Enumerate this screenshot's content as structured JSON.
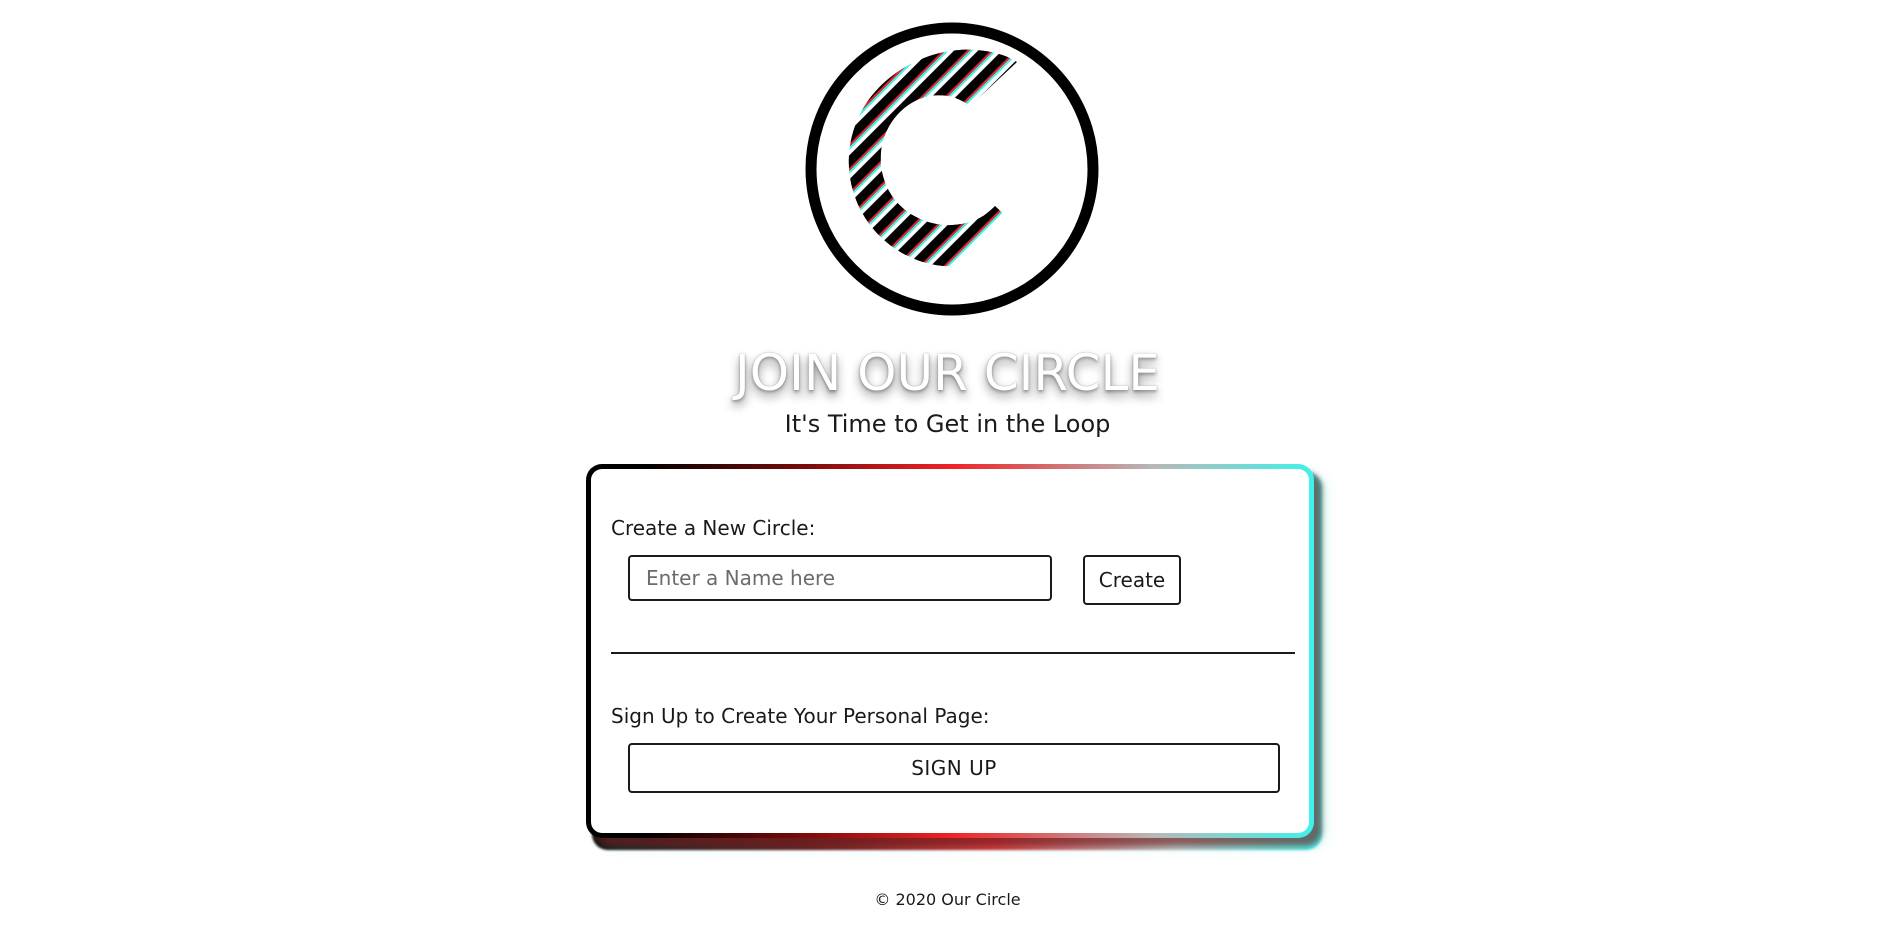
{
  "logo": {
    "icon": "our-circle-logo-icon",
    "accent_colors": [
      "#000000",
      "#e0262b",
      "#3ff2ea"
    ]
  },
  "hero": {
    "title": "JOIN OUR CIRCLE",
    "subtitle": "It's Time to Get in the Loop"
  },
  "card": {
    "create_label": "Create a New Circle:",
    "name_input": {
      "placeholder": "Enter a Name here",
      "value": ""
    },
    "create_button": "Create",
    "signup_label": "Sign Up to Create Your Personal Page:",
    "signup_button": "SIGN UP",
    "border_gradient": [
      "#000000",
      "#ef2226",
      "#3ff2ea"
    ]
  },
  "footer": {
    "text": "© 2020 Our Circle"
  }
}
